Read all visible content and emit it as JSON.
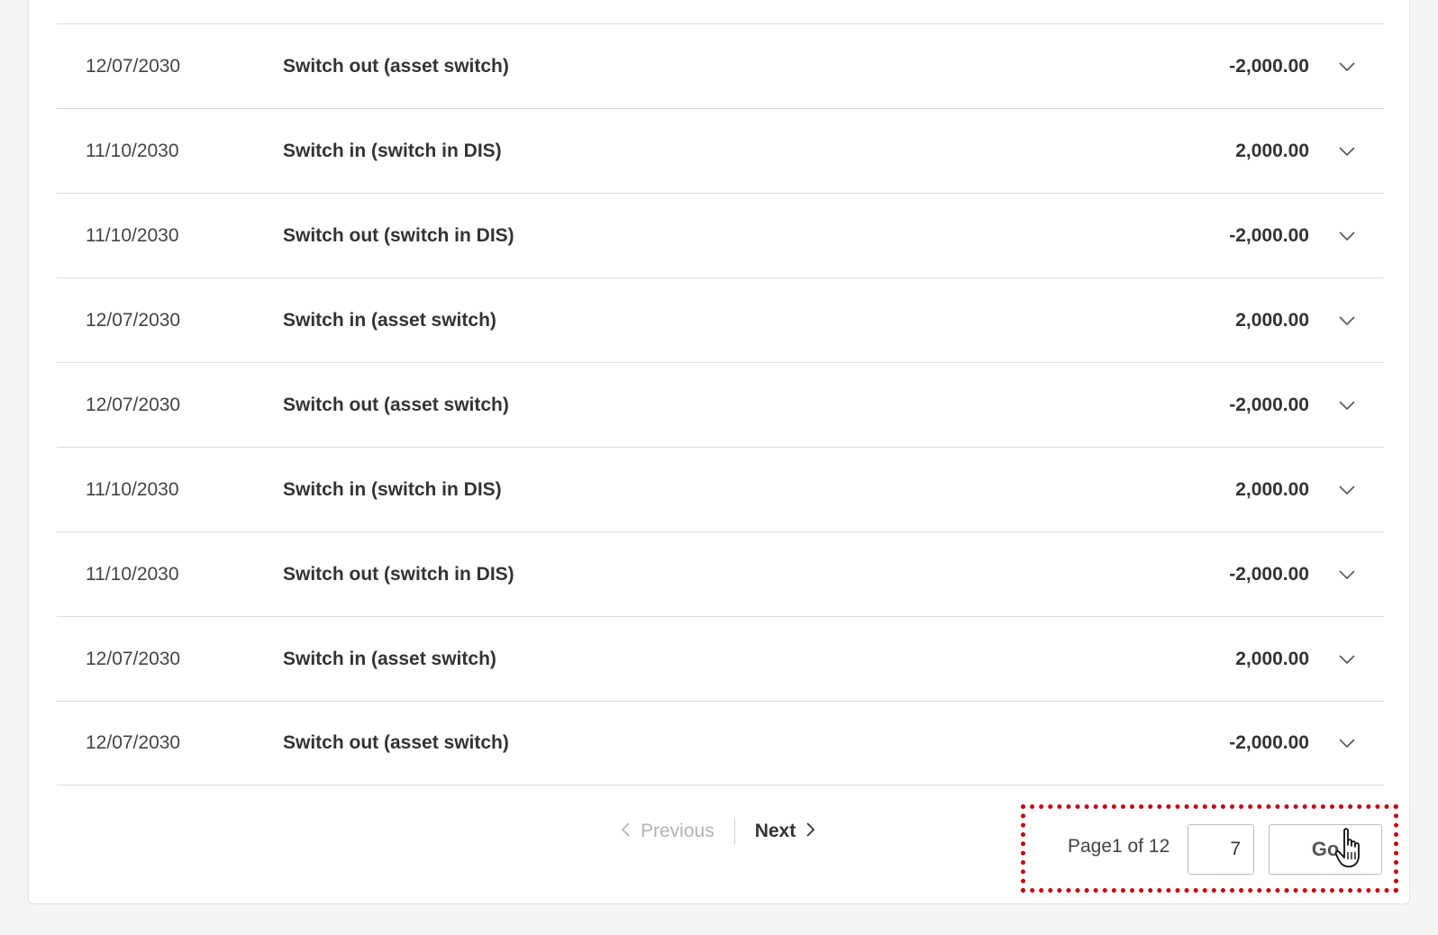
{
  "transactions": [
    {
      "date": "12/07/2030",
      "description": "Switch out (asset switch)",
      "amount": "-2,000.00"
    },
    {
      "date": "11/10/2030",
      "description": "Switch in (switch in DIS)",
      "amount": "2,000.00"
    },
    {
      "date": "11/10/2030",
      "description": "Switch out (switch in DIS)",
      "amount": "-2,000.00"
    },
    {
      "date": "12/07/2030",
      "description": "Switch in (asset switch)",
      "amount": "2,000.00"
    },
    {
      "date": "12/07/2030",
      "description": "Switch out (asset switch)",
      "amount": "-2,000.00"
    },
    {
      "date": "11/10/2030",
      "description": "Switch in (switch in DIS)",
      "amount": "2,000.00"
    },
    {
      "date": "11/10/2030",
      "description": "Switch out (switch in DIS)",
      "amount": "-2,000.00"
    },
    {
      "date": "12/07/2030",
      "description": "Switch in (asset switch)",
      "amount": "2,000.00"
    },
    {
      "date": "12/07/2030",
      "description": "Switch out (asset switch)",
      "amount": "-2,000.00"
    }
  ],
  "pagination": {
    "previous_label": "Previous",
    "next_label": "Next",
    "page_label": "Page1 of 12",
    "page_input_value": "7",
    "go_label": "Go"
  },
  "icons": {
    "row_expand": "chevron-down-icon",
    "previous": "chevron-left-icon",
    "next": "chevron-right-icon",
    "cursor": "hand-pointer-icon"
  },
  "colors": {
    "highlight_border": "#c4000d",
    "disabled_text": "#b3b3b3"
  }
}
